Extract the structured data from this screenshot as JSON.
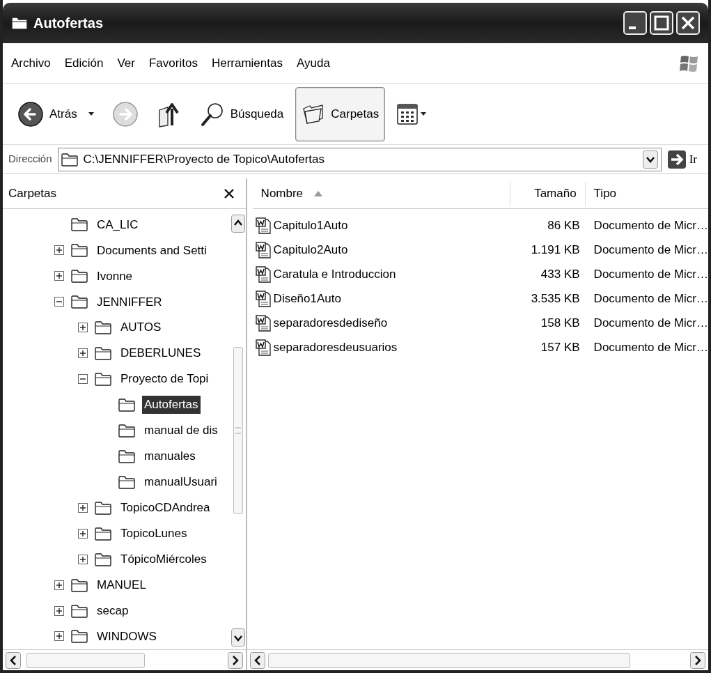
{
  "window": {
    "title": "Autofertas"
  },
  "menu": [
    "Archivo",
    "Edición",
    "Ver",
    "Favoritos",
    "Herramientas",
    "Ayuda"
  ],
  "toolbar": [
    {
      "kind": "back",
      "label": "Atrás",
      "disabled": false,
      "pressed": false
    },
    {
      "kind": "forward",
      "disabled": true,
      "pressed": false
    },
    {
      "kind": "up",
      "disabled": false,
      "pressed": false
    },
    {
      "kind": "search",
      "label": "Búsqueda",
      "disabled": false,
      "pressed": false
    },
    {
      "kind": "folders",
      "label": "Carpetas",
      "disabled": false,
      "pressed": true
    },
    {
      "kind": "views",
      "disabled": false,
      "pressed": false
    }
  ],
  "address": {
    "label": "Dirección",
    "value": "C:\\JENNIFFER\\Proyecto de Topico\\Autofertas",
    "go": "Ir"
  },
  "folders_pane": {
    "title": "Carpetas",
    "tree": [
      {
        "label": "CA_LIC",
        "kind": "leaf",
        "selected": false
      },
      {
        "label": "Documents and Setti",
        "kind": "collapsed",
        "selected": false
      },
      {
        "label": "Ivonne",
        "kind": "collapsed",
        "selected": false
      },
      {
        "label": "JENNIFFER",
        "kind": "expanded",
        "selected": false,
        "children": [
          {
            "label": "AUTOS",
            "kind": "collapsed",
            "selected": false
          },
          {
            "label": "DEBERLUNES",
            "kind": "collapsed",
            "selected": false
          },
          {
            "label": "Proyecto de Topi",
            "kind": "expanded",
            "selected": false,
            "children": [
              {
                "label": "Autofertas",
                "kind": "leaf",
                "selected": true
              },
              {
                "label": "manual de dis",
                "kind": "leaf",
                "selected": false
              },
              {
                "label": "manuales",
                "kind": "leaf",
                "selected": false
              },
              {
                "label": "manualUsuari",
                "kind": "leaf",
                "selected": false
              }
            ]
          },
          {
            "label": "TopicoCDAndrea",
            "kind": "collapsed",
            "selected": false
          },
          {
            "label": "TopicoLunes",
            "kind": "collapsed",
            "selected": false
          },
          {
            "label": "TópicoMiércoles",
            "kind": "collapsed",
            "selected": false
          }
        ]
      },
      {
        "label": "MANUEL",
        "kind": "collapsed",
        "selected": false
      },
      {
        "label": "secap",
        "kind": "collapsed",
        "selected": false
      },
      {
        "label": "WINDOWS",
        "kind": "collapsed",
        "selected": false
      }
    ]
  },
  "file_list": {
    "columns": [
      {
        "label": "Nombre",
        "sorted": true
      },
      {
        "label": "Tamaño",
        "sorted": false
      },
      {
        "label": "Tipo",
        "sorted": false
      }
    ],
    "rows": [
      {
        "name": "Capitulo1Auto",
        "size": "86 KB",
        "type": "Documento de Micr…"
      },
      {
        "name": "Capitulo2Auto",
        "size": "1.191 KB",
        "type": "Documento de Micr…"
      },
      {
        "name": "Caratula e Introduccion",
        "size": "433 KB",
        "type": "Documento de Micr…"
      },
      {
        "name": "Diseño1Auto",
        "size": "3.535 KB",
        "type": "Documento de Micr…"
      },
      {
        "name": "separadoresdediseño",
        "size": "158 KB",
        "type": "Documento de Micr…"
      },
      {
        "name": "separadoresdeusuarios",
        "size": "157 KB",
        "type": "Documento de Micr…"
      }
    ]
  }
}
